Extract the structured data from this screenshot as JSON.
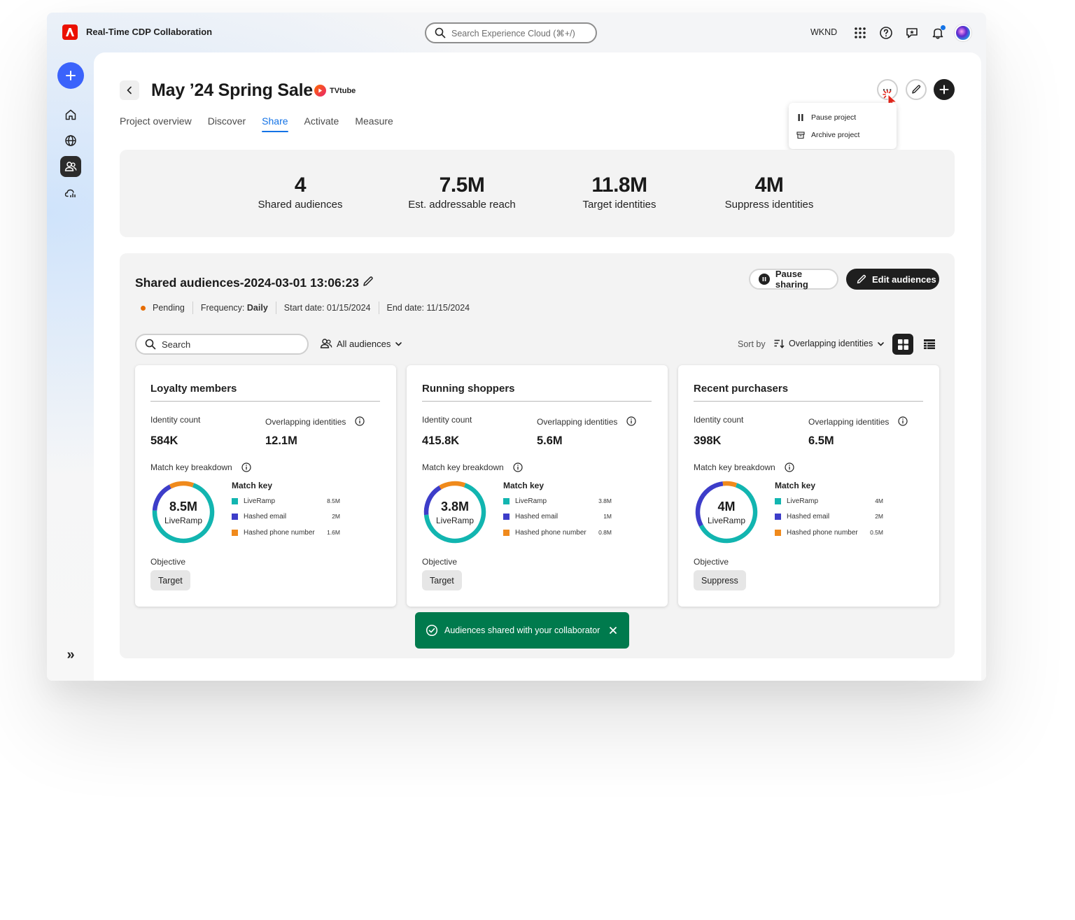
{
  "app": {
    "name": "Real-Time CDP Collaboration",
    "search_placeholder": "Search Experience Cloud (⌘+/)",
    "org": "WKND"
  },
  "rail": {
    "items": [
      "add-icon",
      "home-icon",
      "globe-icon",
      "audiences-icon",
      "cloud-chart-icon"
    ],
    "active": "audiences-icon",
    "expand_glyph": "»"
  },
  "project": {
    "title": "May ’24 Spring Sale",
    "partner": "TVtube",
    "more_glyph": "···",
    "menu": [
      {
        "label": "Pause project",
        "icon": "pause-icon"
      },
      {
        "label": "Archive project",
        "icon": "archive-icon"
      }
    ]
  },
  "tabs": [
    {
      "label": "Project overview",
      "active": false
    },
    {
      "label": "Discover",
      "active": false
    },
    {
      "label": "Share",
      "active": true
    },
    {
      "label": "Activate",
      "active": false
    },
    {
      "label": "Measure",
      "active": false
    }
  ],
  "stats": [
    {
      "value": "4",
      "label": "Shared audiences"
    },
    {
      "value": "7.5M",
      "label": "Est. addressable reach"
    },
    {
      "value": "11.8M",
      "label": "Target identities"
    },
    {
      "value": "4M",
      "label": "Suppress identities"
    }
  ],
  "share": {
    "title": "Shared audiences-2024-03-01 13:06:23",
    "status": "Pending",
    "frequency_label": "Frequency:",
    "frequency_value": "Daily",
    "start_date": "Start date: 01/15/2024",
    "end_date": "End date: 11/15/2024",
    "pause_label": "Pause sharing",
    "edit_label": "Edit audiences",
    "search_placeholder": "Search",
    "filter_label": "All audiences",
    "sort_label": "Sort by",
    "sort_value": "Overlapping identities"
  },
  "cards": [
    {
      "title": "Loyalty members",
      "identity_count_label": "Identity count",
      "identity_count": "584K",
      "overlap_label": "Overlapping identities",
      "overlap": "12.1M",
      "breakdown_label": "Match key breakdown",
      "center_value": "8.5M",
      "center_label": "LiveRamp",
      "match_key_title": "Match key",
      "keys": [
        {
          "name": "LiveRamp",
          "value": "8.5M",
          "num": 8.5
        },
        {
          "name": "Hashed email",
          "value": "2M",
          "num": 2
        },
        {
          "name": "Hashed phone number",
          "value": "1.6M",
          "num": 1.6
        }
      ],
      "objective_label": "Objective",
      "objective": "Target"
    },
    {
      "title": "Running shoppers",
      "identity_count_label": "Identity count",
      "identity_count": "415.8K",
      "overlap_label": "Overlapping identities",
      "overlap": "5.6M",
      "breakdown_label": "Match key breakdown",
      "center_value": "3.8M",
      "center_label": "LiveRamp",
      "match_key_title": "Match key",
      "keys": [
        {
          "name": "LiveRamp",
          "value": "3.8M",
          "num": 3.8
        },
        {
          "name": "Hashed email",
          "value": "1M",
          "num": 1
        },
        {
          "name": "Hashed phone number",
          "value": "0.8M",
          "num": 0.8
        }
      ],
      "objective_label": "Objective",
      "objective": "Target"
    },
    {
      "title": "Recent purchasers",
      "identity_count_label": "Identity count",
      "identity_count": "398K",
      "overlap_label": "Overlapping identities",
      "overlap": "6.5M",
      "breakdown_label": "Match key breakdown",
      "center_value": "4M",
      "center_label": "LiveRamp",
      "match_key_title": "Match key",
      "keys": [
        {
          "name": "LiveRamp",
          "value": "4M",
          "num": 4
        },
        {
          "name": "Hashed email",
          "value": "2M",
          "num": 2
        },
        {
          "name": "Hashed phone number",
          "value": "0.5M",
          "num": 0.5
        }
      ],
      "objective_label": "Objective",
      "objective": "Suppress"
    }
  ],
  "toast": {
    "message": "Audiences shared with your collaborator"
  },
  "colors": {
    "accent": "#1473e6",
    "add_button": "#3b63fb",
    "brand": "#eb1000",
    "liveramp": "#12b5b0",
    "hashed_email": "#3d3dc9",
    "hashed_phone": "#f08a1c",
    "toast": "#007a4d",
    "pending": "#e66c00"
  }
}
